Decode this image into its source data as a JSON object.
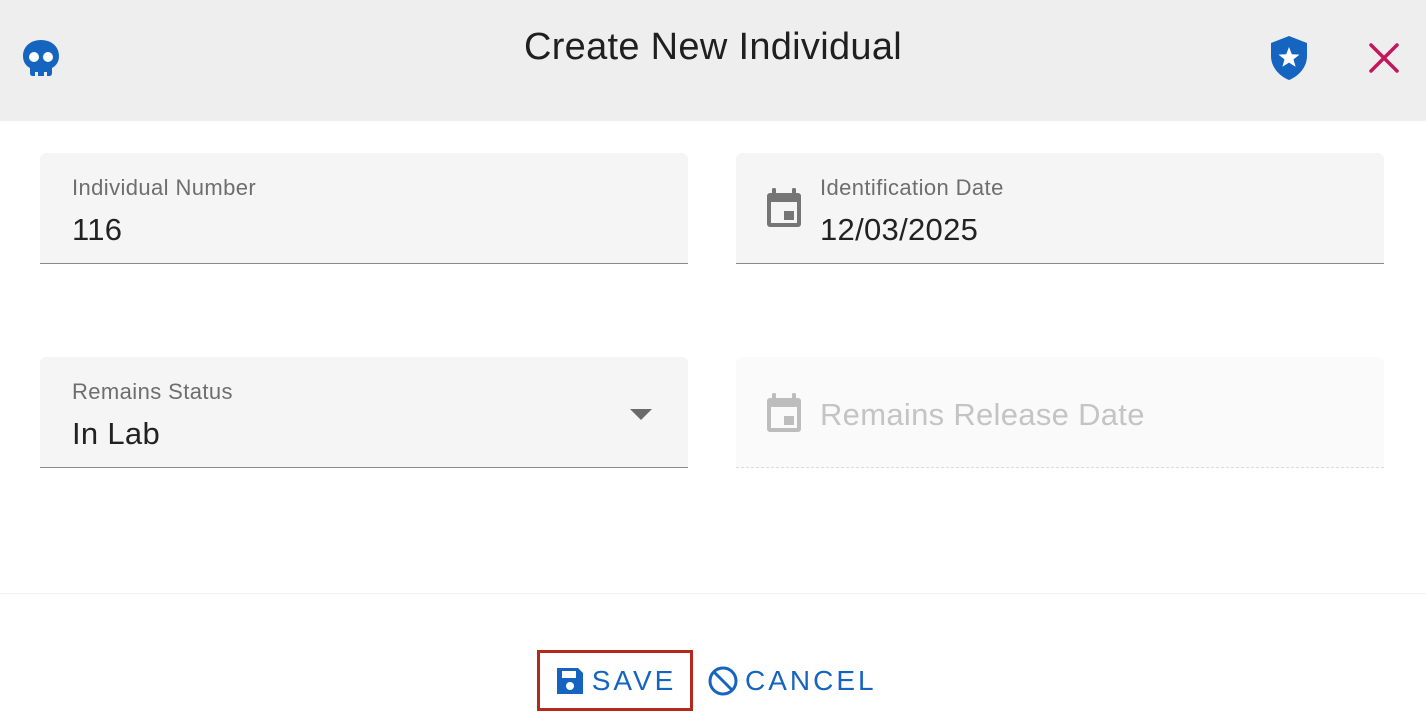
{
  "header": {
    "title": "Create New Individual",
    "left_icon": "skull-icon",
    "right_icons": [
      "shield-star-icon",
      "close-icon"
    ]
  },
  "fields": {
    "individual_number": {
      "label": "Individual Number",
      "value": "116"
    },
    "identification_date": {
      "label": "Identification Date",
      "value": "12/03/2025",
      "icon": "calendar-icon"
    },
    "remains_status": {
      "label": "Remains Status",
      "value": "In Lab",
      "icon": "dropdown-arrow-icon"
    },
    "remains_release_date": {
      "placeholder": "Remains Release Date",
      "icon": "calendar-icon",
      "disabled": true
    }
  },
  "actions": {
    "save_label": "SAVE",
    "cancel_label": "CANCEL"
  },
  "colors": {
    "accent": "#1565c0",
    "close": "#c2185b",
    "highlight_border": "#b5281c",
    "header_bg": "#eeeeee"
  }
}
